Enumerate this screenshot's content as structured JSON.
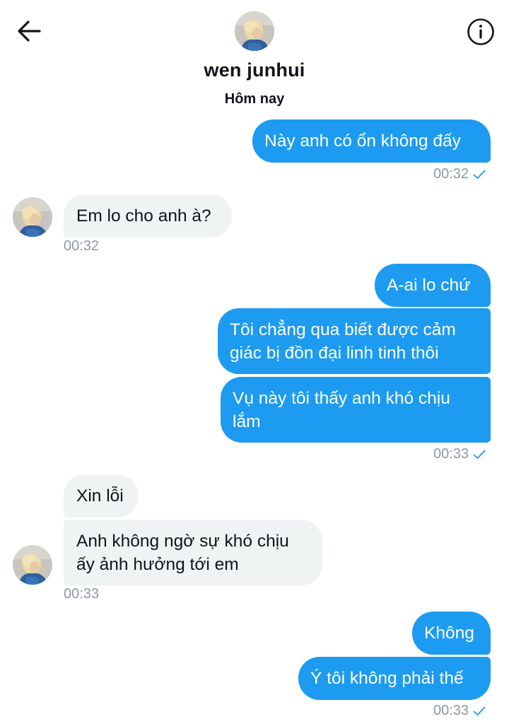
{
  "header": {
    "back_icon": "arrow-left-icon",
    "info_icon": "info-circle-icon",
    "contact_name": "wen junhui",
    "date_separator": "Hôm nay"
  },
  "colors": {
    "outgoing_bubble": "#1d9bf0",
    "incoming_bubble": "#eff3f4",
    "timestamp": "#8b98a5",
    "read_check": "#1d9bf0"
  },
  "messages": [
    {
      "direction": "out",
      "text": "Này anh có ổn không đấy"
    },
    {
      "direction": "in",
      "text": "Em lo cho anh à?"
    },
    {
      "direction": "out",
      "text": "A-ai lo chứ"
    },
    {
      "direction": "out",
      "lines": [
        "Tôi chẳng qua biết được cảm",
        "giác bị đồn đại linh tinh thôi"
      ]
    },
    {
      "direction": "out",
      "lines": [
        "Vụ này tôi thấy anh khó chịu",
        "lắm"
      ]
    },
    {
      "direction": "in",
      "text": "Xin lỗi"
    },
    {
      "direction": "in",
      "lines": [
        "Anh không ngờ sự khó chịu",
        "ấy ảnh hưởng tới em"
      ]
    },
    {
      "direction": "out",
      "text": "Không"
    },
    {
      "direction": "out",
      "text": "Ý tôi không phải thế"
    }
  ],
  "timestamps": [
    "00:32",
    "00:32",
    "00:33",
    "00:33",
    "00:33"
  ]
}
